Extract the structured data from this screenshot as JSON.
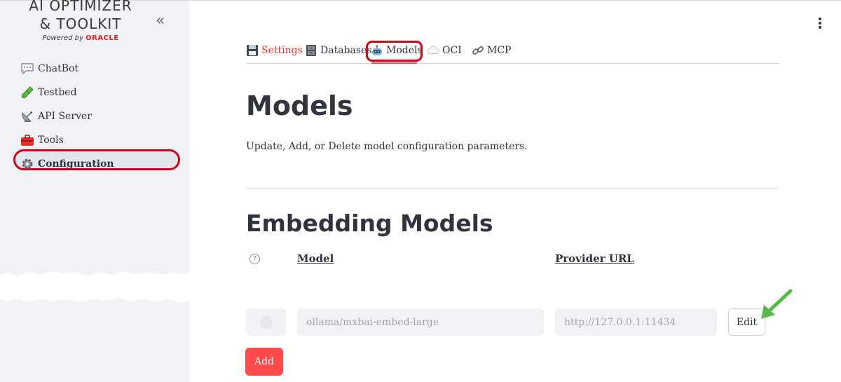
{
  "sidebar": {
    "logo": {
      "line1": "AI OPTIMIZER",
      "line2": "& TOOLKIT",
      "powered_by": "Powered by",
      "brand": "ORACLE"
    },
    "collapse_label": "«",
    "items": [
      {
        "label": "ChatBot",
        "icon": "speech-bubble-icon"
      },
      {
        "label": "Testbed",
        "icon": "test-tube-icon"
      },
      {
        "label": "API Server",
        "icon": "satellite-dish-icon"
      },
      {
        "label": "Tools",
        "icon": "toolbox-icon"
      },
      {
        "label": "Configuration",
        "icon": "gear-icon",
        "active": true
      }
    ]
  },
  "tabs": [
    {
      "label": "Settings",
      "icon": "floppy-disk-icon"
    },
    {
      "label": "Databases",
      "icon": "cabinet-icon"
    },
    {
      "label": "Models",
      "icon": "robot-icon",
      "selected": true
    },
    {
      "label": "OCI",
      "icon": "cloud-icon"
    },
    {
      "label": "MCP",
      "icon": "link-icon"
    }
  ],
  "page": {
    "title": "Models",
    "description": "Update, Add, or Delete model configuration parameters."
  },
  "embedding": {
    "section_title": "Embedding Models",
    "help": "?",
    "columns": {
      "model": "Model",
      "provider_url": "Provider URL"
    },
    "rows": [
      {
        "model": "ollama/mxbai-embed-large",
        "provider_url": "http://127.0.0.1:11434",
        "edit_label": "Edit"
      }
    ],
    "add_label": "Add"
  },
  "colors": {
    "accent": "#ff4b4b",
    "highlight_ring": "#d0021b",
    "sidebar_bg": "#f0f2f6",
    "arrow": "#59b84a"
  }
}
